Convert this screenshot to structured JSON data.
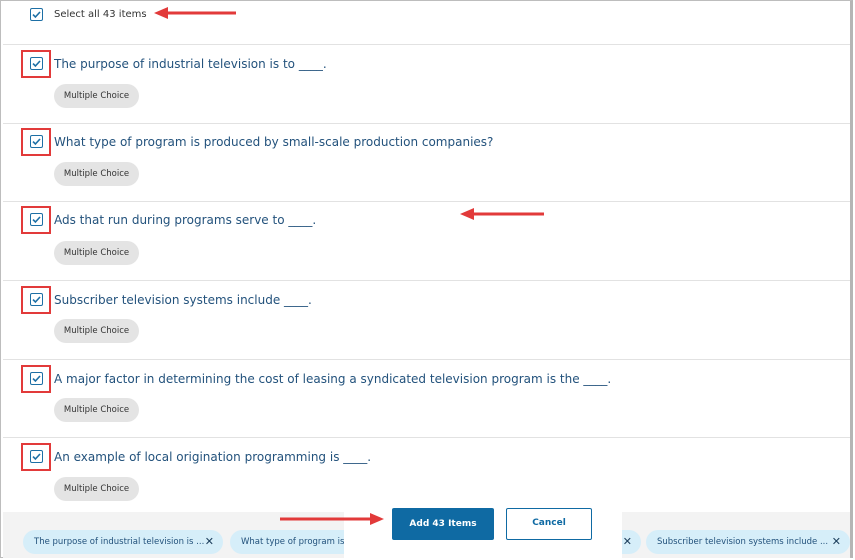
{
  "select_all": {
    "label": "Select all 43 items",
    "checked": true
  },
  "questions": [
    {
      "text": "The purpose of industrial television is to ____.",
      "type": "Multiple Choice",
      "checked": true
    },
    {
      "text": "What type of program is produced by small-scale production companies?",
      "type": "Multiple Choice",
      "checked": true
    },
    {
      "text": "Ads that run during programs serve to ____.",
      "type": "Multiple Choice",
      "checked": true
    },
    {
      "text": "Subscriber television systems include ____.",
      "type": "Multiple Choice",
      "checked": true
    },
    {
      "text": "A major factor in determining the cost of leasing a syndicated television program is the ____.",
      "type": "Multiple Choice",
      "checked": true
    },
    {
      "text": "An example of local origination programming is ____.",
      "type": "Multiple Choice",
      "checked": true
    }
  ],
  "footer": {
    "add_label": "Add 43 Items",
    "cancel_label": "Cancel",
    "chips": [
      {
        "label": "The purpose of industrial television is ..."
      },
      {
        "label": "What type of program is p"
      },
      {
        "label": "Subscriber television systems include ..."
      }
    ],
    "chip_close": "✕"
  },
  "colors": {
    "accent": "#0f6aa3",
    "link": "#23527c",
    "highlight": "#e23a3a",
    "chip": "#d6eef9"
  }
}
